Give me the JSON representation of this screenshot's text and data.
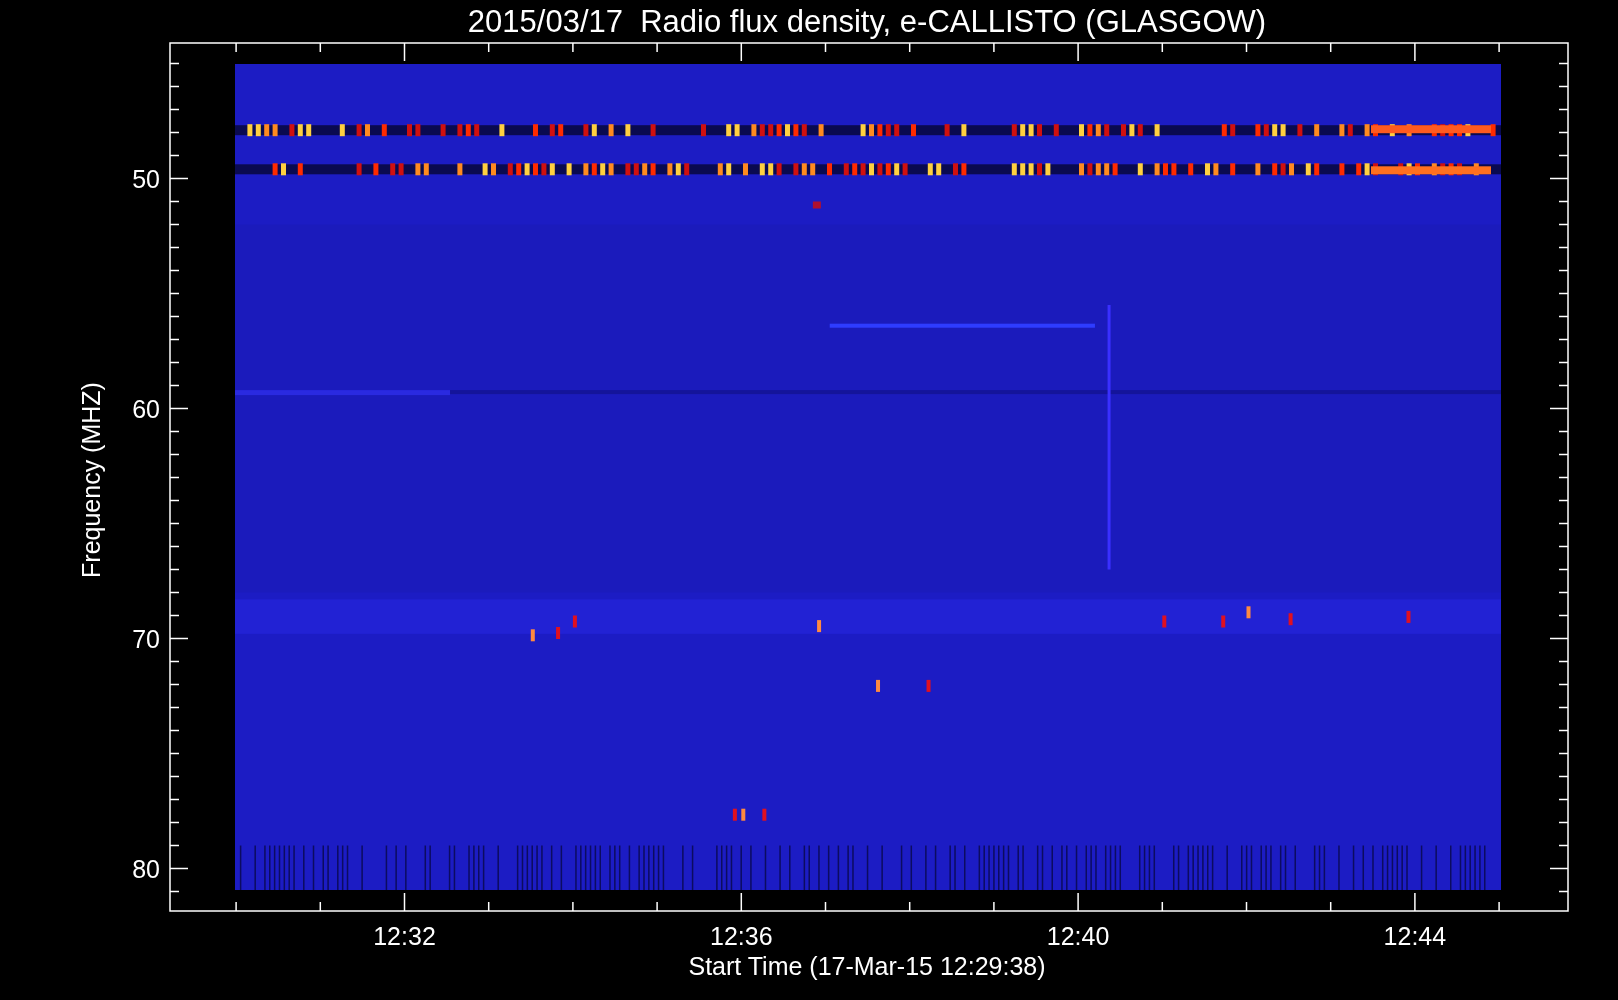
{
  "title": "2015/03/17  Radio flux density, e-CALLISTO (GLASGOW)",
  "y_axis": {
    "label": "Frequency (MHZ)",
    "ticks": [
      "50",
      "60",
      "70",
      "80"
    ]
  },
  "x_axis": {
    "label": "Start Time (17-Mar-15 12:29:38)",
    "ticks": [
      "12:32",
      "12:36",
      "12:40",
      "12:44"
    ]
  }
}
